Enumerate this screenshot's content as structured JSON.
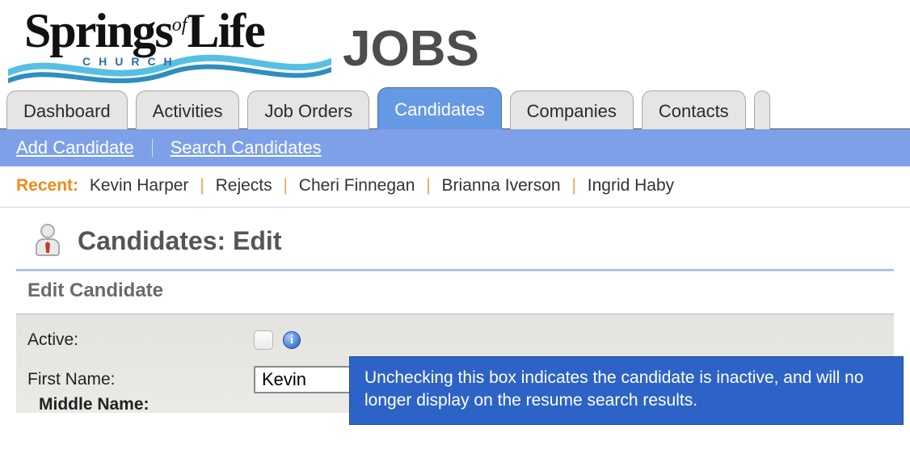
{
  "brand": {
    "word1": "Springs",
    "word_of": "of",
    "word2": "Life",
    "subword": "CHURCH",
    "jobs": "JOBS"
  },
  "tabs": [
    {
      "label": "Dashboard",
      "active": false
    },
    {
      "label": "Activities",
      "active": false
    },
    {
      "label": "Job Orders",
      "active": false
    },
    {
      "label": "Candidates",
      "active": true
    },
    {
      "label": "Companies",
      "active": false
    },
    {
      "label": "Contacts",
      "active": false
    }
  ],
  "subnav": {
    "add": "Add Candidate",
    "search": "Search Candidates"
  },
  "recent": {
    "label": "Recent:",
    "items": [
      "Kevin Harper",
      "Rejects",
      "Cheri Finnegan",
      "Brianna Iverson",
      "Ingrid Haby"
    ]
  },
  "page": {
    "title": "Candidates: Edit",
    "section": "Edit Candidate"
  },
  "form": {
    "active_label": "Active:",
    "first_name_label": "First Name:",
    "first_name_value": "Kevin",
    "middle_name_label": "Middle Name:"
  },
  "tooltip": {
    "text": "Unchecking this box indicates the candidate is inactive, and will no longer display on the resume search results."
  },
  "icons": {
    "info_glyph": "i"
  }
}
